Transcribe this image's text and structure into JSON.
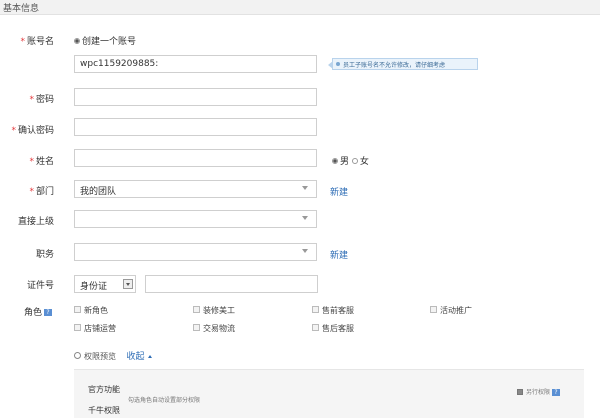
{
  "section": {
    "title": "基本信息"
  },
  "account": {
    "label": "账号名",
    "option": "创建一个账号",
    "value": "wpc1159209885:",
    "tip": "员工子账号名不允许修改，请仔细考虑"
  },
  "password": {
    "label": "密码"
  },
  "confirm_password": {
    "label": "确认密码"
  },
  "name": {
    "label": "姓名",
    "male": "男",
    "female": "女"
  },
  "department": {
    "label": "部门",
    "value": "我的团队",
    "new_link": "新建"
  },
  "supervisor": {
    "label": "直接上级"
  },
  "position": {
    "label": "职务",
    "new_link": "新建"
  },
  "id_number": {
    "label": "证件号",
    "type": "身份证"
  },
  "roles": {
    "label": "角色",
    "help": "?",
    "items": [
      "新角色",
      "装修美工",
      "售前客服",
      "活动推广",
      "店铺运营",
      "交易物流",
      "售后客服"
    ]
  },
  "permissions": {
    "preview_link": "权限预览",
    "collapse_link": "收起",
    "official": "官方功能",
    "hint": "勾选角色自动设置部分权限",
    "qianniu": "千牛权限",
    "supplement": "另行权限"
  },
  "colors": {
    "required": "#e4393c",
    "link": "#2d6cb5",
    "tip_bg": "#eaf3fb"
  }
}
